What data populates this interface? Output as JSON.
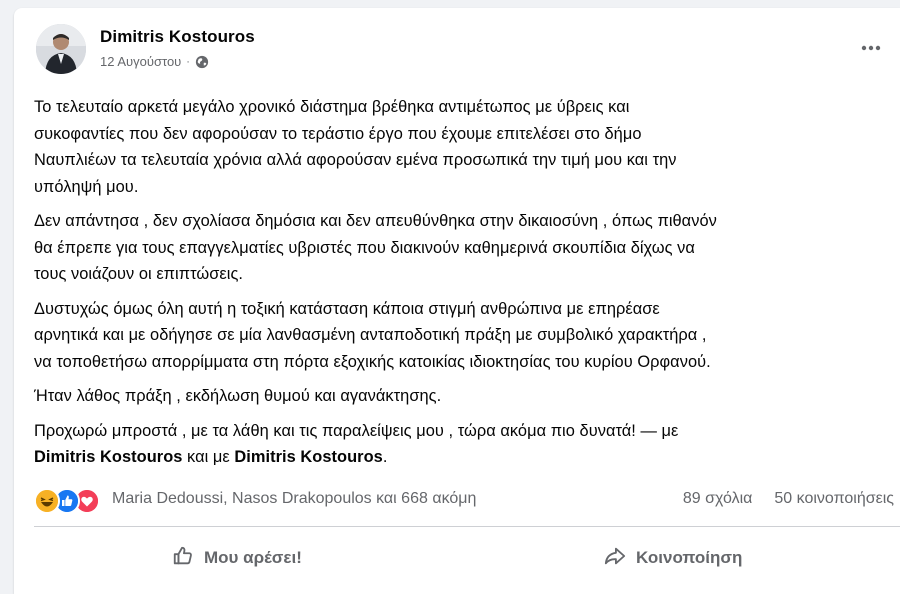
{
  "post": {
    "author": "Dimitris Kostouros",
    "date": "12 Αυγούστου",
    "separator": "·",
    "paragraphs": [
      "Το τελευταίο αρκετά μεγάλο χρονικό διάστημα βρέθηκα αντιμέτωπος με ύβρεις και\nσυκοφαντίες που δεν αφορούσαν το τεράστιο έργο που έχουμε επιτελέσει στο δήμο\nΝαυπλιέων τα τελευταία χρόνια αλλά αφορούσαν εμένα προσωπικά την τιμή μου και την\nυπόληψή μου.",
      "Δεν απάντησα , δεν σχολίασα δημόσια και δεν απευθύνθηκα στην δικαιοσύνη  , όπως πιθανόν\nθα έπρεπε για τους επαγγελματίες υβριστές που διακινούν καθημερινά σκουπίδια  δίχως να\nτους νοιάζουν οι επιπτώσεις.",
      "Δυστυχώς όμως όλη αυτή η τοξική κατάσταση κάποια στιγμή ανθρώπινα με επηρέασε\nαρνητικά  και με οδήγησε σε μία λανθασμένη ανταποδοτική πράξη με συμβολικό χαρακτήρα ,\nνα  τοποθετήσω απορρίμματα στη πόρτα εξοχικής κατοικίας ιδιοκτησίας του κυρίου Ορφανού.",
      "Ήταν λάθος πράξη , εκδήλωση θυμού και αγανάκτησης."
    ],
    "last_paragraph": {
      "text": "Προχωρώ μπροστά , με τα λάθη και τις παραλείψεις μου , τώρα ακόμα πιο δυνατά! — με",
      "tag1": "Dimitris Kostouros",
      "connector": " και με ",
      "tag2": "Dimitris Kostouros",
      "end": "."
    }
  },
  "reactions": {
    "icons": [
      "haha-icon",
      "like-icon",
      "love-icon"
    ],
    "names": "Maria Dedoussi, Nasos Drakopoulos και 668 ακόμη",
    "comments": "89 σχόλια",
    "shares": "50 κοινοποιήσεις"
  },
  "actions": {
    "like_label": "Μου αρέσει!",
    "share_label": "Κοινοποίηση"
  },
  "colors": {
    "like_blue": "#1877f2",
    "love_red": "#f33e58",
    "haha_yellow": "#f7b125",
    "secondary_text": "#65676b"
  }
}
